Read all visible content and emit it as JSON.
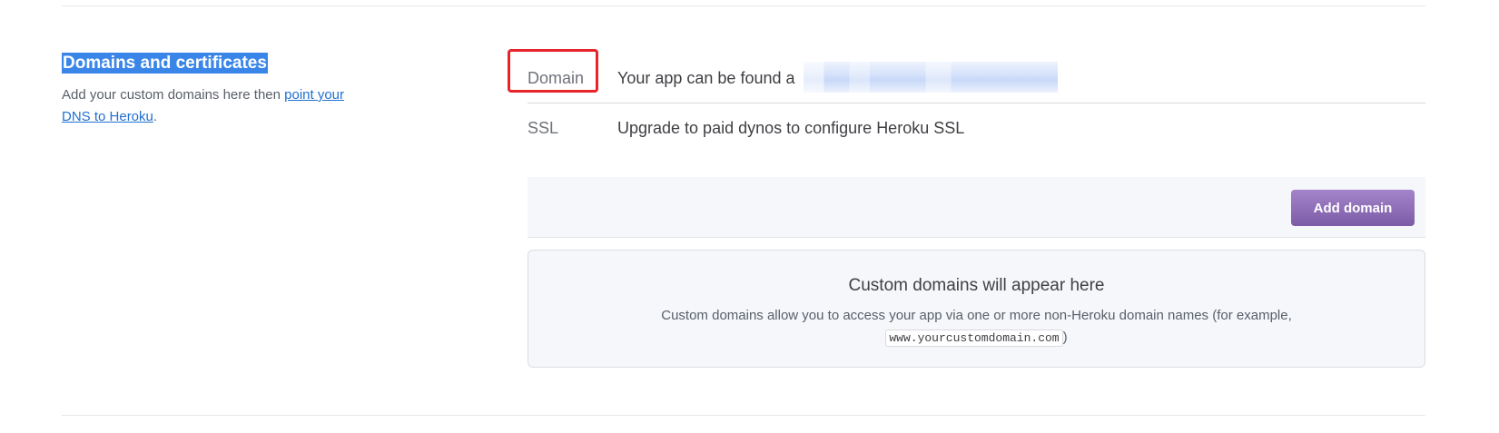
{
  "section": {
    "title": "Domains and certificates",
    "description_prefix": "Add your custom domains here then ",
    "description_link": "point your DNS to Heroku",
    "description_suffix": "."
  },
  "rows": {
    "domain": {
      "label": "Domain",
      "value": "Your app can be found a"
    },
    "ssl": {
      "label": "SSL",
      "value": "Upgrade to paid dynos to configure Heroku SSL"
    }
  },
  "actions": {
    "add_domain": "Add domain"
  },
  "empty_state": {
    "title": "Custom domains will appear here",
    "description": "Custom domains allow you to access your app via one or more non-Heroku domain names (for example,",
    "example_domain": "www.yourcustomdomain.com",
    "closing": ")"
  },
  "colors": {
    "accent_purple": "#7c5ba6",
    "highlight_red": "#e8242b",
    "selection_blue": "#3a86e8",
    "link_blue": "#1f6fd1"
  }
}
